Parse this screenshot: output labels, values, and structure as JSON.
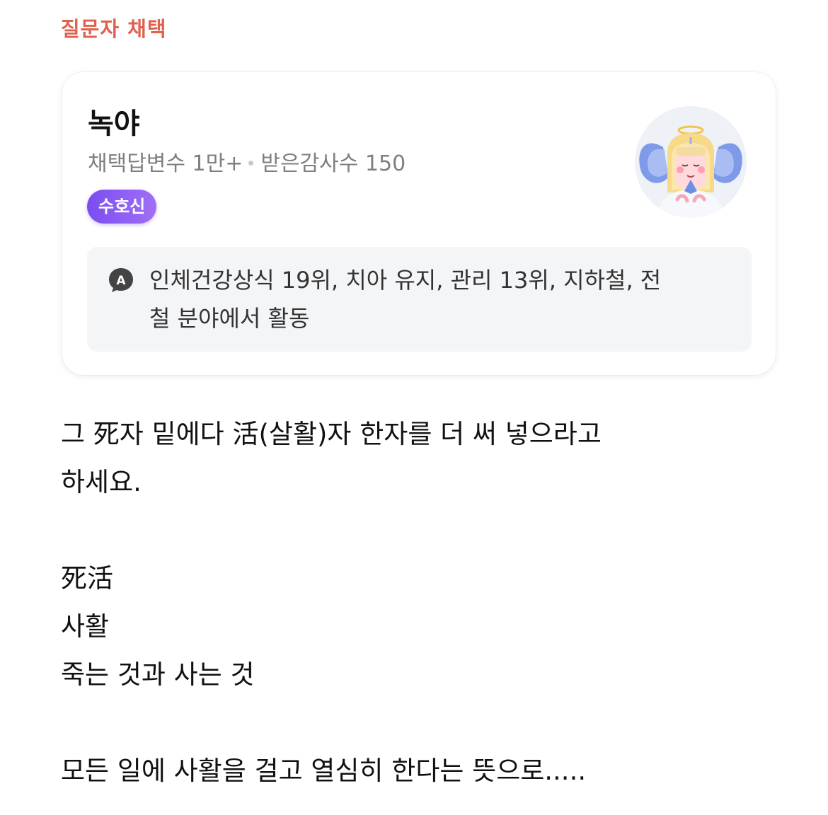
{
  "selected_label": "질문자 채택",
  "profile": {
    "name": "녹야",
    "stats": {
      "answers": "채택답변수 1만+",
      "thanks": "받은감사수 150"
    },
    "badge": "수호신",
    "avatar_icon": "angel-avatar-icon",
    "activity_icon": "a-badge-icon",
    "activity_line1": "인체건강상식 19위, 치아 유지, 관리 13위, 지하철, 전",
    "activity_line2": "철 분야에서 활동"
  },
  "answer": {
    "line1": "그 死자 밑에다 活(살활)자 한자를 더 써 넣으라고",
    "line2": "하세요.",
    "line3": "死活",
    "line4": "사활",
    "line5": "죽는 것과 사는 것",
    "line6": "모든 일에 사활을 걸고 열심히 한다는 뜻으로....."
  },
  "colors": {
    "accent": "#e0614f",
    "badge": "#7a4df0",
    "panel": "#f4f5f7"
  }
}
